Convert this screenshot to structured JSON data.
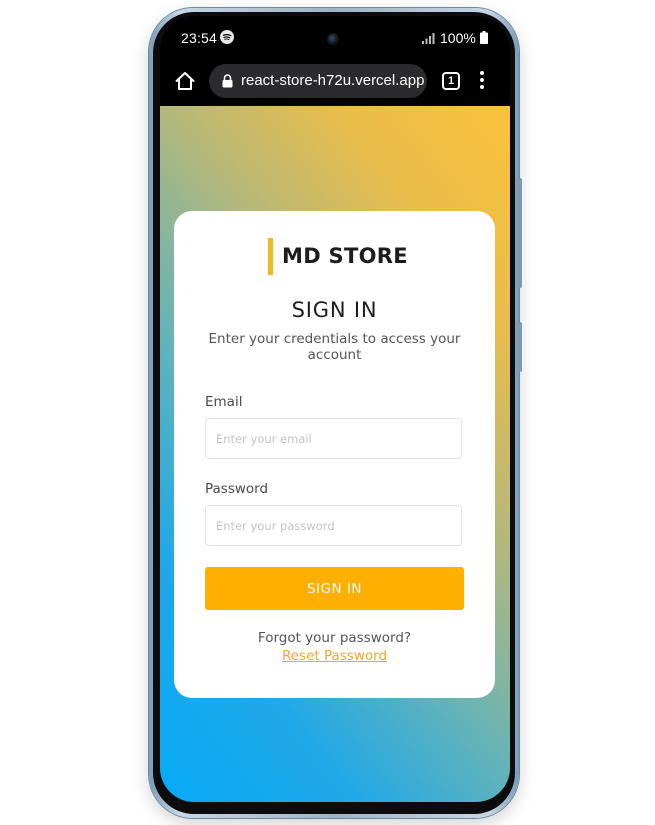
{
  "status_bar": {
    "time": "23:54",
    "battery": "100%",
    "icons": [
      "spotify-icon",
      "camera-icon",
      "signal-icon",
      "battery-icon"
    ]
  },
  "browser": {
    "url": "react-store-h72u.vercel.app",
    "tab_count": "1",
    "icons": [
      "home-icon",
      "lock-icon",
      "tabs-icon",
      "more-vert-icon"
    ]
  },
  "card": {
    "brand": "MD STORE",
    "title": "SIGN IN",
    "subtitle": "Enter your credentials to access your account",
    "email_label": "Email",
    "email_placeholder": "Enter your email",
    "email_value": "",
    "password_label": "Password",
    "password_placeholder": "Enter your password",
    "password_value": "",
    "submit_label": "SIGN IN",
    "forgot_text": "Forgot your password?",
    "reset_link": "Reset Password"
  },
  "colors": {
    "accent": "#ffaf00",
    "brand_bar": "#f0bb1c",
    "link": "#f5a623",
    "gradient_start": "#06aaf6",
    "gradient_end": "#fbc23a"
  }
}
